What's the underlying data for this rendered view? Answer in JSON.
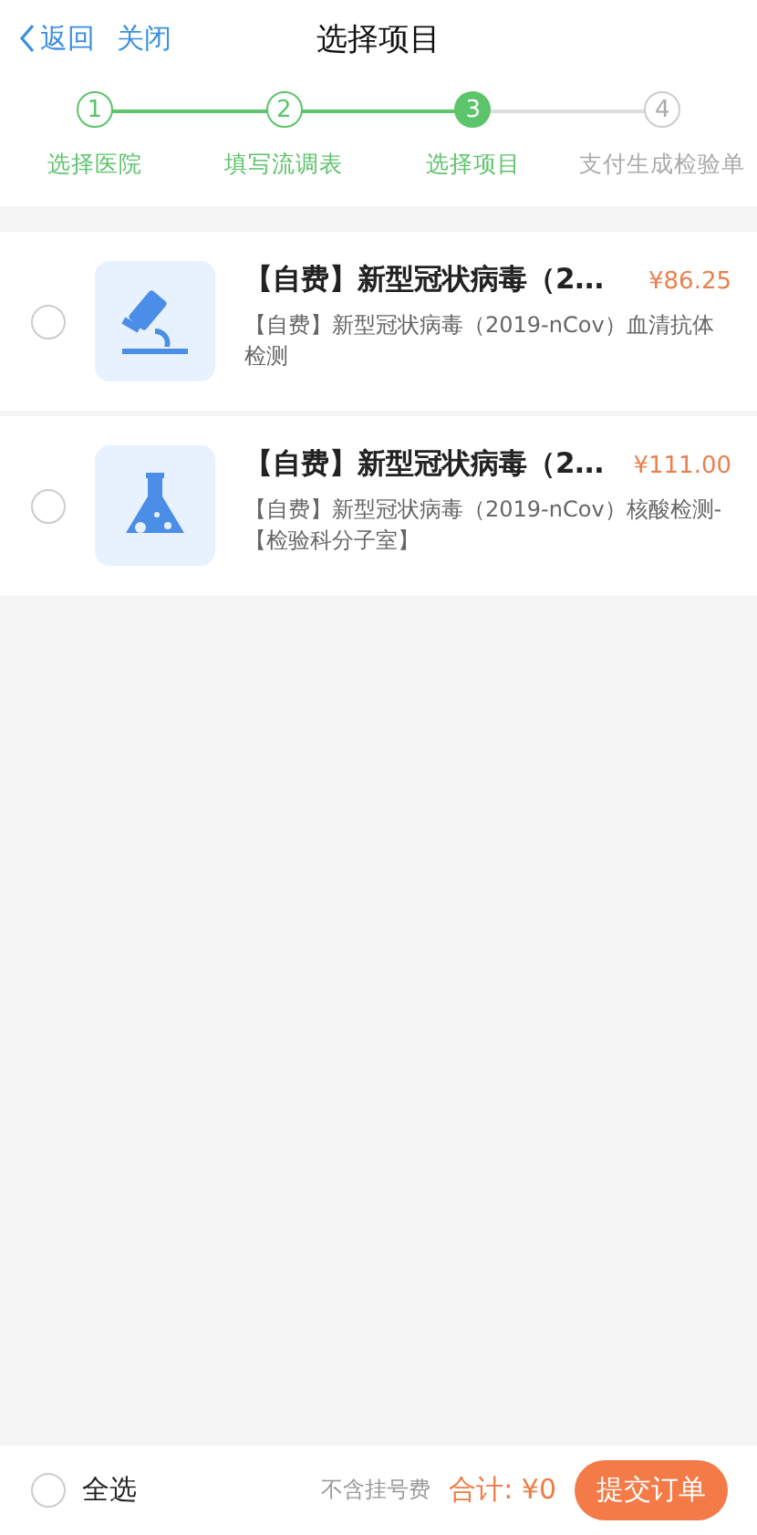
{
  "nav": {
    "back": "返回",
    "close": "关闭",
    "title": "选择项目"
  },
  "steps": [
    {
      "number": "1",
      "label": "选择医院",
      "done": true,
      "selected": false
    },
    {
      "number": "2",
      "label": "填写流调表",
      "done": true,
      "selected": false
    },
    {
      "number": "3",
      "label": "选择项目",
      "done": true,
      "selected": true
    },
    {
      "number": "4",
      "label": "支付生成检验单",
      "done": false,
      "selected": false
    }
  ],
  "items": [
    {
      "kind": "microscope",
      "title": "【自费】新型冠状病毒（2...",
      "price": "¥86.25",
      "description": "【自费】新型冠状病毒（2019-nCov）血清抗体检测",
      "checked": false
    },
    {
      "kind": "flask",
      "title": "【自费】新型冠状病毒（2...",
      "price": "¥111.00",
      "description": "【自费】新型冠状病毒（2019-nCov）核酸检测-【检验科分子室】",
      "checked": false
    }
  ],
  "footer": {
    "select_all": "全选",
    "select_all_checked": false,
    "note": "不含挂号费",
    "total": "合计: ¥0",
    "submit": "提交订单"
  }
}
